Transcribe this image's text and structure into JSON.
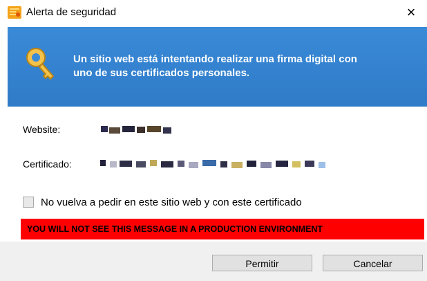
{
  "window": {
    "title": "Alerta de seguridad",
    "close_glyph": "×"
  },
  "banner": {
    "message_line1": "Un sitio web está intentando realizar una firma digital con",
    "message_line2": "uno de sus certificados personales.",
    "background_color": "#3a8ad8",
    "icon": "key-icon"
  },
  "details": {
    "website_label": "Website:",
    "certificate_label": "Certificado:"
  },
  "option": {
    "checkbox_label": "No vuelva a pedir en este sitio web y con este certificado",
    "checked": false
  },
  "warning": {
    "text": "YOU WILL NOT SEE THIS MESSAGE IN A PRODUCTION ENVIRONMENT",
    "background_color": "#ff0000"
  },
  "buttons": {
    "allow_label": "Permitir",
    "cancel_label": "Cancelar"
  }
}
